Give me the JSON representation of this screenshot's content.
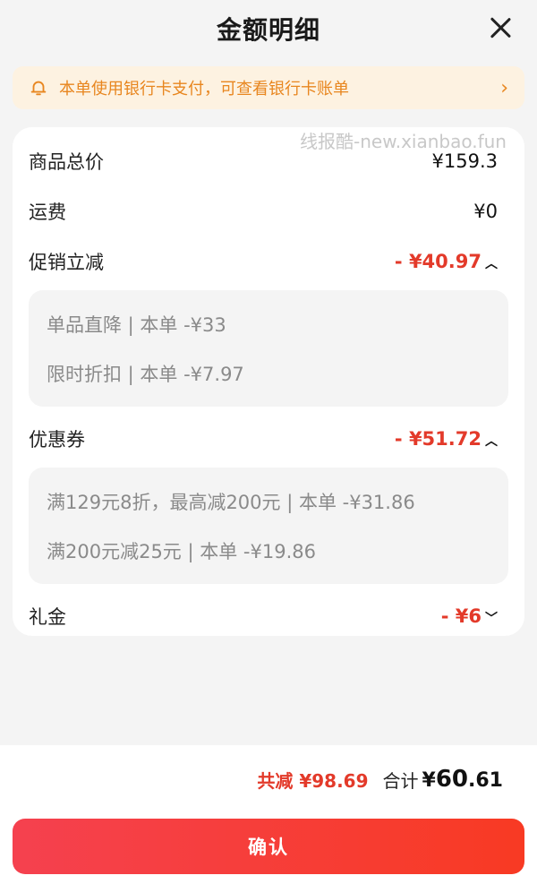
{
  "header": {
    "title": "金额明细"
  },
  "notice": {
    "text": "本单使用银行卡支付，可查看银行卡账单"
  },
  "watermark": "线报酷-new.xianbao.fun",
  "rows": {
    "goods_total": {
      "label": "商品总价",
      "value": "¥159.3"
    },
    "shipping": {
      "label": "运费",
      "value": "¥0"
    },
    "promo": {
      "label": "促销立减",
      "value": "- ¥40.97",
      "items": [
        "单品直降 | 本单 -¥33",
        "限时折扣 | 本单 -¥7.97"
      ]
    },
    "coupon": {
      "label": "优惠券",
      "value": "- ¥51.72",
      "items": [
        "满129元8折，最高减200元 | 本单 -¥31.86",
        "满200元减25元 | 本单 -¥19.86"
      ]
    },
    "gift": {
      "label": "礼金",
      "value": "- ¥6"
    }
  },
  "footer": {
    "saved": "共减 ¥98.69",
    "total_label": "合计",
    "total_prefix": "¥",
    "total_int": "60",
    "total_dec": ".61",
    "confirm": "确认"
  },
  "colors": {
    "accent_red": "#e33a2a",
    "notice_orange": "#e8861f",
    "notice_bg": "#fdf2e1"
  }
}
